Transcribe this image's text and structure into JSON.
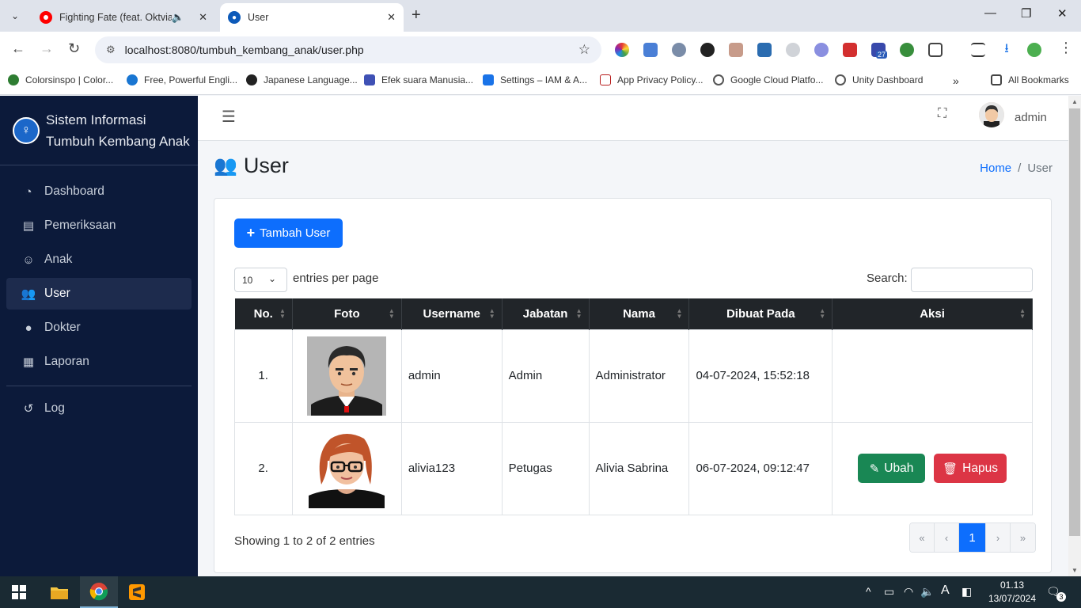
{
  "browser": {
    "tabs": [
      {
        "title": "Fighting Fate (feat. Oktvia)",
        "active": false
      },
      {
        "title": "User",
        "active": true
      }
    ],
    "url": "localhost:8080/tumbuh_kembang_anak/user.php",
    "bookmarks": [
      "Colorsinspo | Color...",
      "Free, Powerful Engli...",
      "Japanese Language...",
      "Efek suara Manusia...",
      "Settings – IAM & A...",
      "App Privacy Policy...",
      "Google Cloud Platfo...",
      "Unity Dashboard"
    ],
    "all_bookmarks": "All Bookmarks",
    "ext_badge": "27"
  },
  "sidebar": {
    "brand_line1": "Sistem Informasi",
    "brand_line2": "Tumbuh Kembang Anak",
    "items": [
      {
        "label": "Dashboard",
        "icon": "gauge-icon"
      },
      {
        "label": "Pemeriksaan",
        "icon": "clipboard-icon"
      },
      {
        "label": "Anak",
        "icon": "child-icon"
      },
      {
        "label": "User",
        "icon": "users-icon",
        "active": true
      },
      {
        "label": "Dokter",
        "icon": "doctor-icon"
      },
      {
        "label": "Laporan",
        "icon": "file-icon"
      }
    ],
    "log_label": "Log"
  },
  "topbar": {
    "username": "admin"
  },
  "header": {
    "title": "User",
    "breadcrumb": {
      "home": "Home",
      "current": "User"
    }
  },
  "card": {
    "add_button": "Tambah User",
    "perpage_value": "10",
    "perpage_label": "entries per page",
    "search_label": "Search:",
    "columns": [
      "No.",
      "Foto",
      "Username",
      "Jabatan",
      "Nama",
      "Dibuat Pada",
      "Aksi"
    ],
    "rows": [
      {
        "no": "1.",
        "username": "admin",
        "jabatan": "Admin",
        "nama": "Administrator",
        "dibuat": "04-07-2024, 15:52:18"
      },
      {
        "no": "2.",
        "username": "alivia123",
        "jabatan": "Petugas",
        "nama": "Alivia Sabrina",
        "dibuat": "06-07-2024, 09:12:47",
        "edit": "Ubah",
        "delete": "Hapus"
      }
    ],
    "info": "Showing 1 to 2 of 2 entries",
    "pager": {
      "first": "«",
      "prev": "‹",
      "current": "1",
      "next": "›",
      "last": "»"
    }
  },
  "taskbar": {
    "time": "01.13",
    "date": "13/07/2024",
    "notif": "3"
  },
  "colors": {
    "sidebar": "#0c1a3a",
    "primary": "#0d6efd",
    "success": "#198754",
    "danger": "#dc3545",
    "table_head": "#212529"
  }
}
